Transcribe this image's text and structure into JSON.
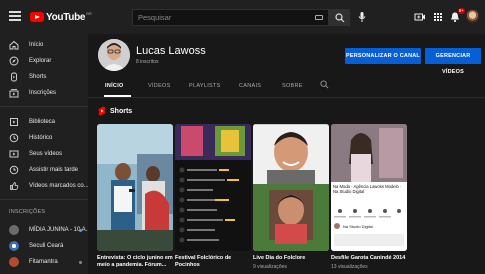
{
  "header": {
    "logo_text": "YouTube",
    "logo_sup": "BR",
    "search_placeholder": "Pesquisar",
    "notifications_count": "9+"
  },
  "sidebar": {
    "items": [
      {
        "label": "Início",
        "icon": "home-icon"
      },
      {
        "label": "Explorar",
        "icon": "compass-icon"
      },
      {
        "label": "Shorts",
        "icon": "shorts-icon"
      },
      {
        "label": "Inscrições",
        "icon": "subscriptions-icon"
      }
    ],
    "library_items": [
      {
        "label": "Biblioteca",
        "icon": "library-icon"
      },
      {
        "label": "Histórico",
        "icon": "history-icon"
      },
      {
        "label": "Seus vídeos",
        "icon": "your-videos-icon"
      },
      {
        "label": "Assistir mais tarde",
        "icon": "clock-icon"
      },
      {
        "label": "Vídeos marcados co...",
        "icon": "thumbs-up-icon"
      }
    ],
    "subscriptions_title": "INSCRIÇÕES",
    "subscriptions": [
      {
        "label": "MÍDIA JUNINA - 10 A...",
        "color": "#6b6b6b",
        "live": true
      },
      {
        "label": "Seculi Ceará",
        "color": "#3b6fb0",
        "live": false
      },
      {
        "label": "Fitamantra",
        "color": "#b44b2c",
        "live": false
      }
    ]
  },
  "channel": {
    "name": "Lucas Lawoss",
    "subscribers": "8 inscritos",
    "customize_label": "PERSONALIZAR O CANAL",
    "manage_label": "GERENCIAR VÍDEOS",
    "accent_color": "#065fd4"
  },
  "tabs": [
    "INÍCIO",
    "VÍDEOS",
    "PLAYLISTS",
    "CANAIS",
    "SOBRE"
  ],
  "shorts": {
    "title": "Shorts",
    "items": [
      {
        "title_line1": "Entrevista: O ciclo junino em",
        "title_line2": "meio a pandemia. Fórum...",
        "views": ""
      },
      {
        "title_line1": "Festival Folclórico de",
        "title_line2": "Pocinhos",
        "views": ""
      },
      {
        "title_line1": "Live Dia do Folclore",
        "title_line2": "",
        "views": "9 visualizações"
      },
      {
        "title_line1": "Desfile Garota Canindé 2014",
        "title_line2": "",
        "views": "13 visualizações"
      }
    ],
    "overlay_text_4": "Na Moda - Agência Lawoss Modelo · Na Studio Digital",
    "overlay_sub_4": "Na Studio Digital"
  }
}
